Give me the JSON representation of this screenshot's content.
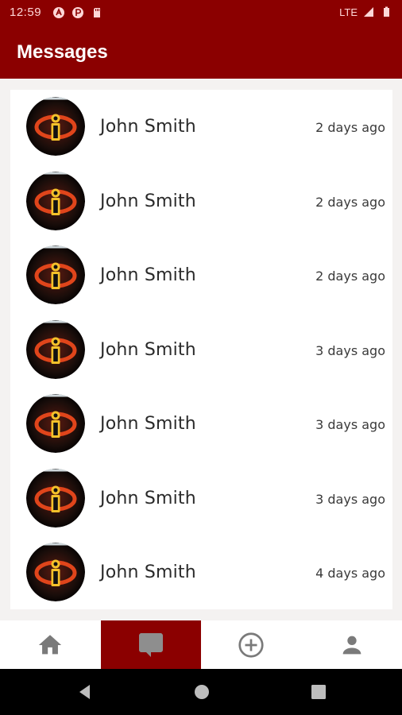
{
  "status_bar": {
    "time": "12:59",
    "network": "LTE"
  },
  "header": {
    "title": "Messages"
  },
  "messages": [
    {
      "name": "John Smith",
      "time": "2 days ago",
      "avatar": "incredibles-logo-avatar"
    },
    {
      "name": "John Smith",
      "time": "2 days ago",
      "avatar": "incredibles-logo-avatar"
    },
    {
      "name": "John Smith",
      "time": "2 days ago",
      "avatar": "incredibles-logo-avatar"
    },
    {
      "name": "John Smith",
      "time": "3 days ago",
      "avatar": "incredibles-logo-avatar"
    },
    {
      "name": "John Smith",
      "time": "3 days ago",
      "avatar": "incredibles-logo-avatar"
    },
    {
      "name": "John Smith",
      "time": "3 days ago",
      "avatar": "incredibles-logo-avatar"
    },
    {
      "name": "John Smith",
      "time": "4 days ago",
      "avatar": "incredibles-logo-avatar"
    }
  ],
  "bottom_nav": [
    {
      "icon": "home-icon",
      "active": false
    },
    {
      "icon": "chat-icon",
      "active": true
    },
    {
      "icon": "add-circle-icon",
      "active": false
    },
    {
      "icon": "person-icon",
      "active": false
    }
  ],
  "colors": {
    "primary": "#8b0000",
    "background": "#f4f2f1",
    "card": "#ffffff",
    "nav_icon": "#7a7a7a"
  }
}
